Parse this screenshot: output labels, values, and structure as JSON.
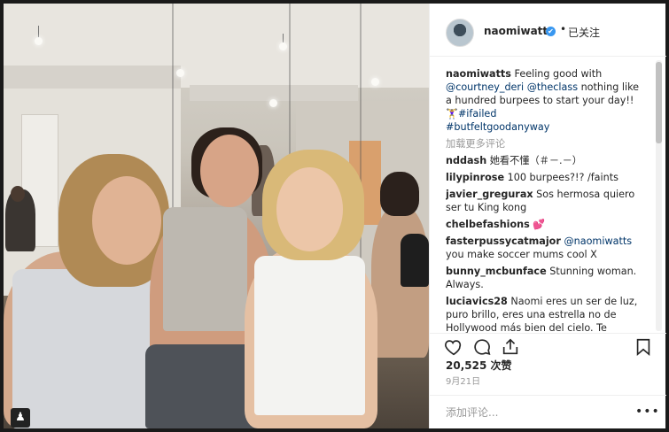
{
  "post": {
    "username": "naomiwatts",
    "verified_mark": "✔",
    "follow_separator": "•",
    "follow_status": "已关注",
    "caption": {
      "username": "naomiwatts",
      "text_1": " Feeling good with ",
      "mention_1": "@courtney_deri",
      "text_2": " ",
      "mention_2": "@theclass",
      "text_3": " nothing like a hundred burpees to start your day!! 🏋️‍♀️",
      "hashtag_1": "#ifailed",
      "hashtag_2": "#butfeltgoodanyway"
    },
    "load_more_label": "加载更多评论",
    "comments": [
      {
        "user": "nddash",
        "text": "她看不懂（＃－.－）"
      },
      {
        "user": "lilypinrose",
        "text": "100 burpees?!? /faints"
      },
      {
        "user": "javier_gregurax",
        "text": "Sos hermosa quiero ser tu King kong"
      },
      {
        "user": "chelbefashions",
        "text": "💕"
      },
      {
        "user": "fasterpussycatmajor",
        "mention": "@naomiwatts",
        "text": "you make soccer mums cool X"
      },
      {
        "user": "bunny_mcbunface",
        "text": "Stunning woman. Always."
      },
      {
        "user": "luciavics28",
        "text": "Naomi eres un ser de luz, puro brillo, eres una estrella no de Hollywood más bien del cielo. Te"
      }
    ],
    "likes": "20,525 次赞",
    "date": "9月21日",
    "add_comment_placeholder": "添加评论...",
    "more_options": "•••"
  },
  "icons": {
    "heart": "heart-icon",
    "comment": "comment-icon",
    "share": "share-icon",
    "bookmark": "bookmark-icon",
    "tag": "tag-people-icon"
  },
  "colors": {
    "link": "#003569",
    "verified": "#3897f0",
    "muted": "#999999",
    "text": "#262626"
  }
}
